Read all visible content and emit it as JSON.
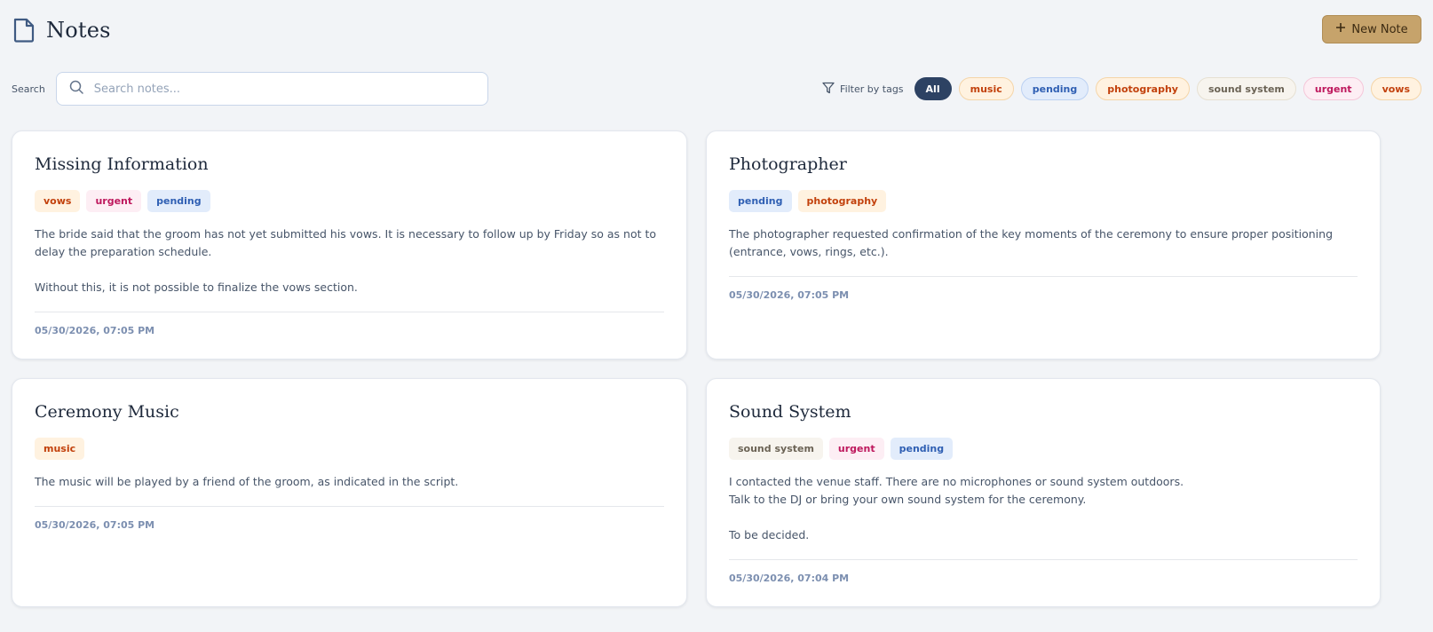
{
  "app": {
    "title": "Notes",
    "new_note_label": "New Note"
  },
  "search": {
    "label": "Search",
    "placeholder": "Search notes..."
  },
  "filter": {
    "label": "Filter by tags",
    "all_label": "All",
    "tags": [
      "music",
      "pending",
      "photography",
      "sound system",
      "urgent",
      "vows"
    ]
  },
  "notes": [
    {
      "title": "Missing Information",
      "tags": [
        "vows",
        "urgent",
        "pending"
      ],
      "body": [
        "The bride said that the groom has not yet submitted his vows. It is necessary to follow up by Friday so as not to delay the preparation schedule.",
        "Without this, it is not possible to finalize the vows section."
      ],
      "date": "05/30/2026, 07:05 PM"
    },
    {
      "title": "Photographer",
      "tags": [
        "pending",
        "photography"
      ],
      "body": [
        "The photographer requested confirmation of the key moments of the ceremony to ensure proper positioning (entrance, vows, rings, etc.)."
      ],
      "date": "05/30/2026, 07:05 PM"
    },
    {
      "title": "Ceremony Music",
      "tags": [
        "music"
      ],
      "body": [
        "The music will be played by a friend of the groom, as indicated in the script."
      ],
      "date": "05/30/2026, 07:05 PM"
    },
    {
      "title": "Sound System",
      "tags": [
        "sound system",
        "urgent",
        "pending"
      ],
      "body": [
        "I contacted the venue staff. There are no microphones or sound system outdoors.",
        "Talk to the DJ or bring your own sound system for the ceremony.",
        "To be decided."
      ],
      "date": "05/30/2026, 07:04 PM"
    }
  ],
  "colors": {
    "accent": "#c6a36b",
    "active_chip": "#2d4263",
    "background": "#f2f4f7"
  }
}
